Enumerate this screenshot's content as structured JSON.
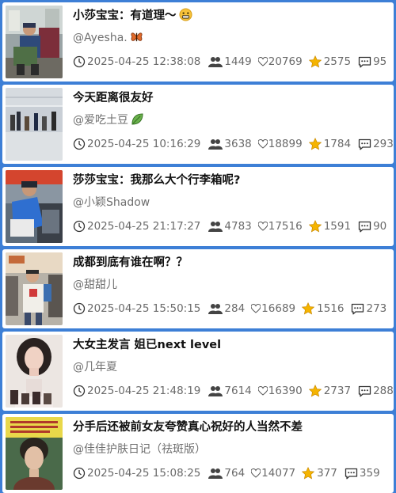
{
  "posts": [
    {
      "title": "小莎宝宝：有道理～",
      "title_emoji": "grimacing-face-emoji",
      "author": "@Ayesha.",
      "author_emoji": "butterfly-emoji",
      "time": "2025-04-25 12:38:08",
      "people": "1449",
      "likes": "20769",
      "stars": "2575",
      "comments": "95",
      "thumb": "airport-boy-with-luggage"
    },
    {
      "title": "今天距离很友好",
      "title_emoji": "",
      "author": "@爱吃土豆",
      "author_emoji": "leaf-emoji",
      "time": "2025-04-25 10:16:29",
      "people": "3638",
      "likes": "18899",
      "stars": "1784",
      "comments": "293",
      "thumb": "airport-terminal-crowd"
    },
    {
      "title": "莎莎宝宝：我那么大个行李箱呢?",
      "title_emoji": "",
      "author": "@小颖Shadow",
      "author_emoji": "",
      "time": "2025-04-25 21:17:27",
      "people": "4783",
      "likes": "17516",
      "stars": "1591",
      "comments": "90",
      "thumb": "player-at-luggage-belt"
    },
    {
      "title": "成都到底有谁在啊？？",
      "title_emoji": "",
      "author": "@甜甜儿",
      "author_emoji": "",
      "time": "2025-04-25 15:50:15",
      "people": "284",
      "likes": "16689",
      "stars": "1516",
      "comments": "273",
      "thumb": "crowd-with-cameras"
    },
    {
      "title": "大女主发言 姐已next level",
      "title_emoji": "",
      "author": "@几年夏",
      "author_emoji": "",
      "time": "2025-04-25 21:48:19",
      "people": "7614",
      "likes": "16390",
      "stars": "2737",
      "comments": "288",
      "thumb": "actress-portrait"
    },
    {
      "title": "分手后还被前女友夸赞真心祝好的人当然不差",
      "title_emoji": "",
      "author": "@佳佳护肤日记（祛斑版）",
      "author_emoji": "",
      "time": "2025-04-25 15:08:25",
      "people": "764",
      "likes": "14077",
      "stars": "377",
      "comments": "359",
      "thumb": "costume-drama-poster"
    }
  ],
  "colors": {
    "background": "#3d7fd6",
    "card": "#ffffff",
    "title": "#111111",
    "meta": "#6a6a6a",
    "star": "#f5b400"
  },
  "icons": [
    "clock-icon",
    "people-icon",
    "heart-icon",
    "star-icon",
    "chat-icon"
  ]
}
